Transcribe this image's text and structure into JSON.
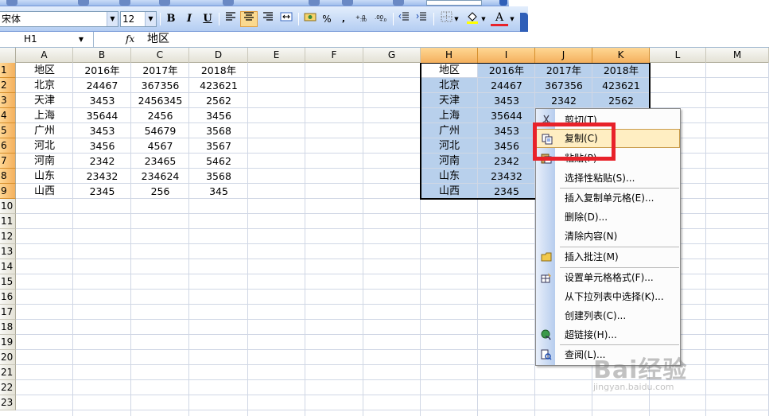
{
  "toolbar": {
    "font_name": "宋体",
    "font_size": "12",
    "bold_label": "B",
    "italic_label": "I",
    "underline_label": "U",
    "percent_label": "%",
    "font_color_label": "A"
  },
  "formula_bar": {
    "name_box": "H1",
    "fx_label": "fx",
    "formula": "地区"
  },
  "columns": [
    "A",
    "B",
    "C",
    "D",
    "E",
    "F",
    "G",
    "H",
    "I",
    "J",
    "K",
    "L",
    "M"
  ],
  "selected_columns": [
    "H",
    "I",
    "J",
    "K"
  ],
  "rows": [
    "1",
    "2",
    "3",
    "4",
    "5",
    "6",
    "7",
    "8",
    "9",
    "10",
    "11",
    "12",
    "13",
    "14",
    "15",
    "16",
    "17",
    "18",
    "19",
    "20",
    "21",
    "22",
    "23"
  ],
  "selected_rows": [
    "1",
    "2",
    "3",
    "4",
    "5",
    "6",
    "7",
    "8",
    "9"
  ],
  "table_left": [
    [
      "地区",
      "2016年",
      "2017年",
      "2018年"
    ],
    [
      "北京",
      "24467",
      "367356",
      "423621"
    ],
    [
      "天津",
      "3453",
      "2456345",
      "2562"
    ],
    [
      "上海",
      "35644",
      "2456",
      "3456"
    ],
    [
      "广州",
      "3453",
      "54679",
      "3568"
    ],
    [
      "河北",
      "3456",
      "4567",
      "3567"
    ],
    [
      "河南",
      "2342",
      "23465",
      "5462"
    ],
    [
      "山东",
      "23432",
      "234624",
      "3568"
    ],
    [
      "山西",
      "2345",
      "256",
      "345"
    ]
  ],
  "table_right": [
    [
      "地区",
      "2016年",
      "2017年",
      "2018年"
    ],
    [
      "北京",
      "24467",
      "367356",
      "423621"
    ],
    [
      "天津",
      "3453",
      "2342",
      "2562"
    ],
    [
      "上海",
      "35644",
      "",
      ""
    ],
    [
      "广州",
      "3453",
      "",
      ""
    ],
    [
      "河北",
      "3456",
      "",
      ""
    ],
    [
      "河南",
      "2342",
      "",
      ""
    ],
    [
      "山东",
      "23432",
      "",
      ""
    ],
    [
      "山西",
      "2345",
      "",
      ""
    ]
  ],
  "context_menu": {
    "items": [
      {
        "label": "剪切(T)",
        "icon": "scissors-icon"
      },
      {
        "label": "复制(C)",
        "icon": "copy-icon",
        "highlighted": true
      },
      {
        "label": "粘贴(P)",
        "icon": "paste-icon"
      },
      {
        "label": "选择性粘贴(S)...",
        "icon": ""
      },
      {
        "label": "插入复制单元格(E)...",
        "icon": ""
      },
      {
        "label": "删除(D)...",
        "icon": ""
      },
      {
        "label": "清除内容(N)",
        "icon": ""
      },
      {
        "label": "插入批注(M)",
        "icon": "comment-icon"
      },
      {
        "label": "设置单元格格式(F)...",
        "icon": "format-cells-icon"
      },
      {
        "label": "从下拉列表中选择(K)...",
        "icon": ""
      },
      {
        "label": "创建列表(C)...",
        "icon": ""
      },
      {
        "label": "超链接(H)...",
        "icon": "hyperlink-icon"
      },
      {
        "label": "查阅(L)...",
        "icon": "research-icon"
      }
    ]
  },
  "watermark": {
    "brand": "Bai经验",
    "url": "jingyan.baidu.com"
  },
  "colors": {
    "selection": "#b8d0ec",
    "header_selected": "#f4b05d",
    "menu_highlight": "#ffeec2",
    "annotation_red": "#e8222a",
    "toolbar_blue": "#b4cdf2"
  }
}
